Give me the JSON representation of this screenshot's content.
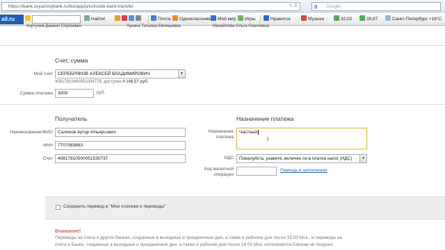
{
  "browser": {
    "url": "https://ibank.svyaznoybank.ru/ibs/app/priv/inside-bank-transfer",
    "search_placeholder": "Google",
    "search_engine_icon": "google-icon"
  },
  "toolbar": {
    "logo_main": "ail",
    "logo_suffix": ".ru",
    "find_label": "Найти!",
    "mail_label": "Почта",
    "ok_label": "Одноклассники",
    "myworld_label": "Мой мир",
    "games_label": "Игры",
    "like_label": "Нравится",
    "music_label": "Музыка",
    "usd": "32,02",
    "eur": "39,97",
    "weather": "Санкт-Петербург +16°С"
  },
  "top_cut": {
    "name1": "Кортупев Даниил Сергеевич",
    "name2": "Лукина Татьяна Евгеньевна",
    "name3": "Михайлова Ольга Сергеевна"
  },
  "account": {
    "section_title": "Счет, сумма",
    "my_account_label": "Мой счет",
    "my_account_value": "СЕРЕБРЯКОВ АЛЕКСЕЙ ВЛАДИМИРОВИЧ",
    "account_hint": "40817810400051054779, доступно",
    "account_balance": "4 146.57 руб.",
    "amount_label": "Сумма платежа",
    "amount_value": "3000",
    "currency": "руб."
  },
  "recipient": {
    "section_title": "Получатель",
    "name_label": "Наименование/ФИО",
    "name_value": "Салихов Артур Ильярсович",
    "inn_label": "ИНН",
    "inn_value": "7707083893",
    "account_label": "Счет",
    "account_value": "40817810500051530737"
  },
  "purpose": {
    "section_title": "Назначение платежа",
    "purpose_label_line1": "Назначение",
    "purpose_label_line2": "платежа",
    "purpose_value": "Частный",
    "vat_label": "НДС",
    "vat_value": "Пожалуйста, укажите, включен ли в платеж налог (НДС)",
    "code_label_line1": "Код валютной",
    "code_label_line2": "операции",
    "code_value": "",
    "help_link": "Помощь в заполнении"
  },
  "save": {
    "label": "Сохранить перевод в \"Мои платежи и переводы\""
  },
  "warning": {
    "title": "Внимание!",
    "line1": "Переводы на счета в других банках, созданные в выходные и праздничные дни, а также в рабочие дни после 15:00 Мск., и переводы на",
    "line2": "счета в Банке, созданные в выходные и праздничные дни, а также в рабочие дни после 18:00 Мск, исполняются Банком не позднее"
  },
  "colors": {
    "accent_link": "#2a5db0",
    "warning": "#c0392b",
    "focus_border": "#e0b84a"
  }
}
